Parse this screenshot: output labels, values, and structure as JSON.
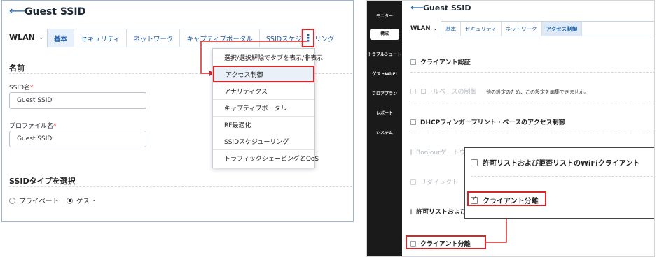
{
  "left": {
    "title": "Guest SSID",
    "wlan_label": "WLAN",
    "tabs": [
      {
        "label": "基本"
      },
      {
        "label": "セキュリティ"
      },
      {
        "label": "ネットワーク"
      },
      {
        "label": "キャプティブポータル"
      },
      {
        "label": "SSIDスケジューリング"
      }
    ],
    "more_icon": "kebab-menu-icon",
    "section_name": "名前",
    "ssid_label": "SSID名",
    "ssid_value": "Guest SSID",
    "profile_label": "プロファイル名",
    "profile_value": "Guest SSID",
    "required_mark": "*",
    "ssid_type_heading": "SSIDタイプを選択",
    "radio_private": "プライベート",
    "radio_guest": "ゲスト",
    "selected_type": "ゲスト",
    "menu": [
      {
        "label": "選択/選択解除でタブを表示/非表示"
      },
      {
        "label": "アクセス制御"
      },
      {
        "label": "アナリティクス"
      },
      {
        "label": "キャプティブポータル"
      },
      {
        "label": "RF最適化"
      },
      {
        "label": "SSIDスケジューリング"
      },
      {
        "label": "トラフィックシェーピングとQoS"
      }
    ]
  },
  "right": {
    "sidebar": [
      {
        "label": "モニター"
      },
      {
        "label": "構成"
      },
      {
        "label": "トラブルシュート"
      },
      {
        "label": "ゲストWi-Fi"
      },
      {
        "label": "フロアプラン"
      },
      {
        "label": "レポート"
      },
      {
        "label": "システム"
      }
    ],
    "title": "Guest SSID",
    "wlan_label": "WLAN",
    "tabs": [
      {
        "label": "基本"
      },
      {
        "label": "セキュリティ"
      },
      {
        "label": "ネットワーク"
      },
      {
        "label": "アクセス制御"
      }
    ],
    "options": [
      {
        "label": "クライアント認証"
      },
      {
        "label": "ロールベースの制御"
      },
      {
        "label": "DHCPフィンガープリント・ベースのアクセス制御"
      },
      {
        "label": "Bonjourゲートウェイ"
      },
      {
        "label": "リダイレクト"
      },
      {
        "label": "許可リストおよび拒否リストのWiFiクライアント"
      },
      {
        "label": "クライアント分離"
      }
    ],
    "role_note": "他の設定のため、この設定を編集できません。",
    "zoom": {
      "option_1": "許可リストおよび拒否リストのWiFiクライアント",
      "option_2": "クライアント分離",
      "option_2_checked": true
    },
    "accent_color": "#d62828"
  }
}
